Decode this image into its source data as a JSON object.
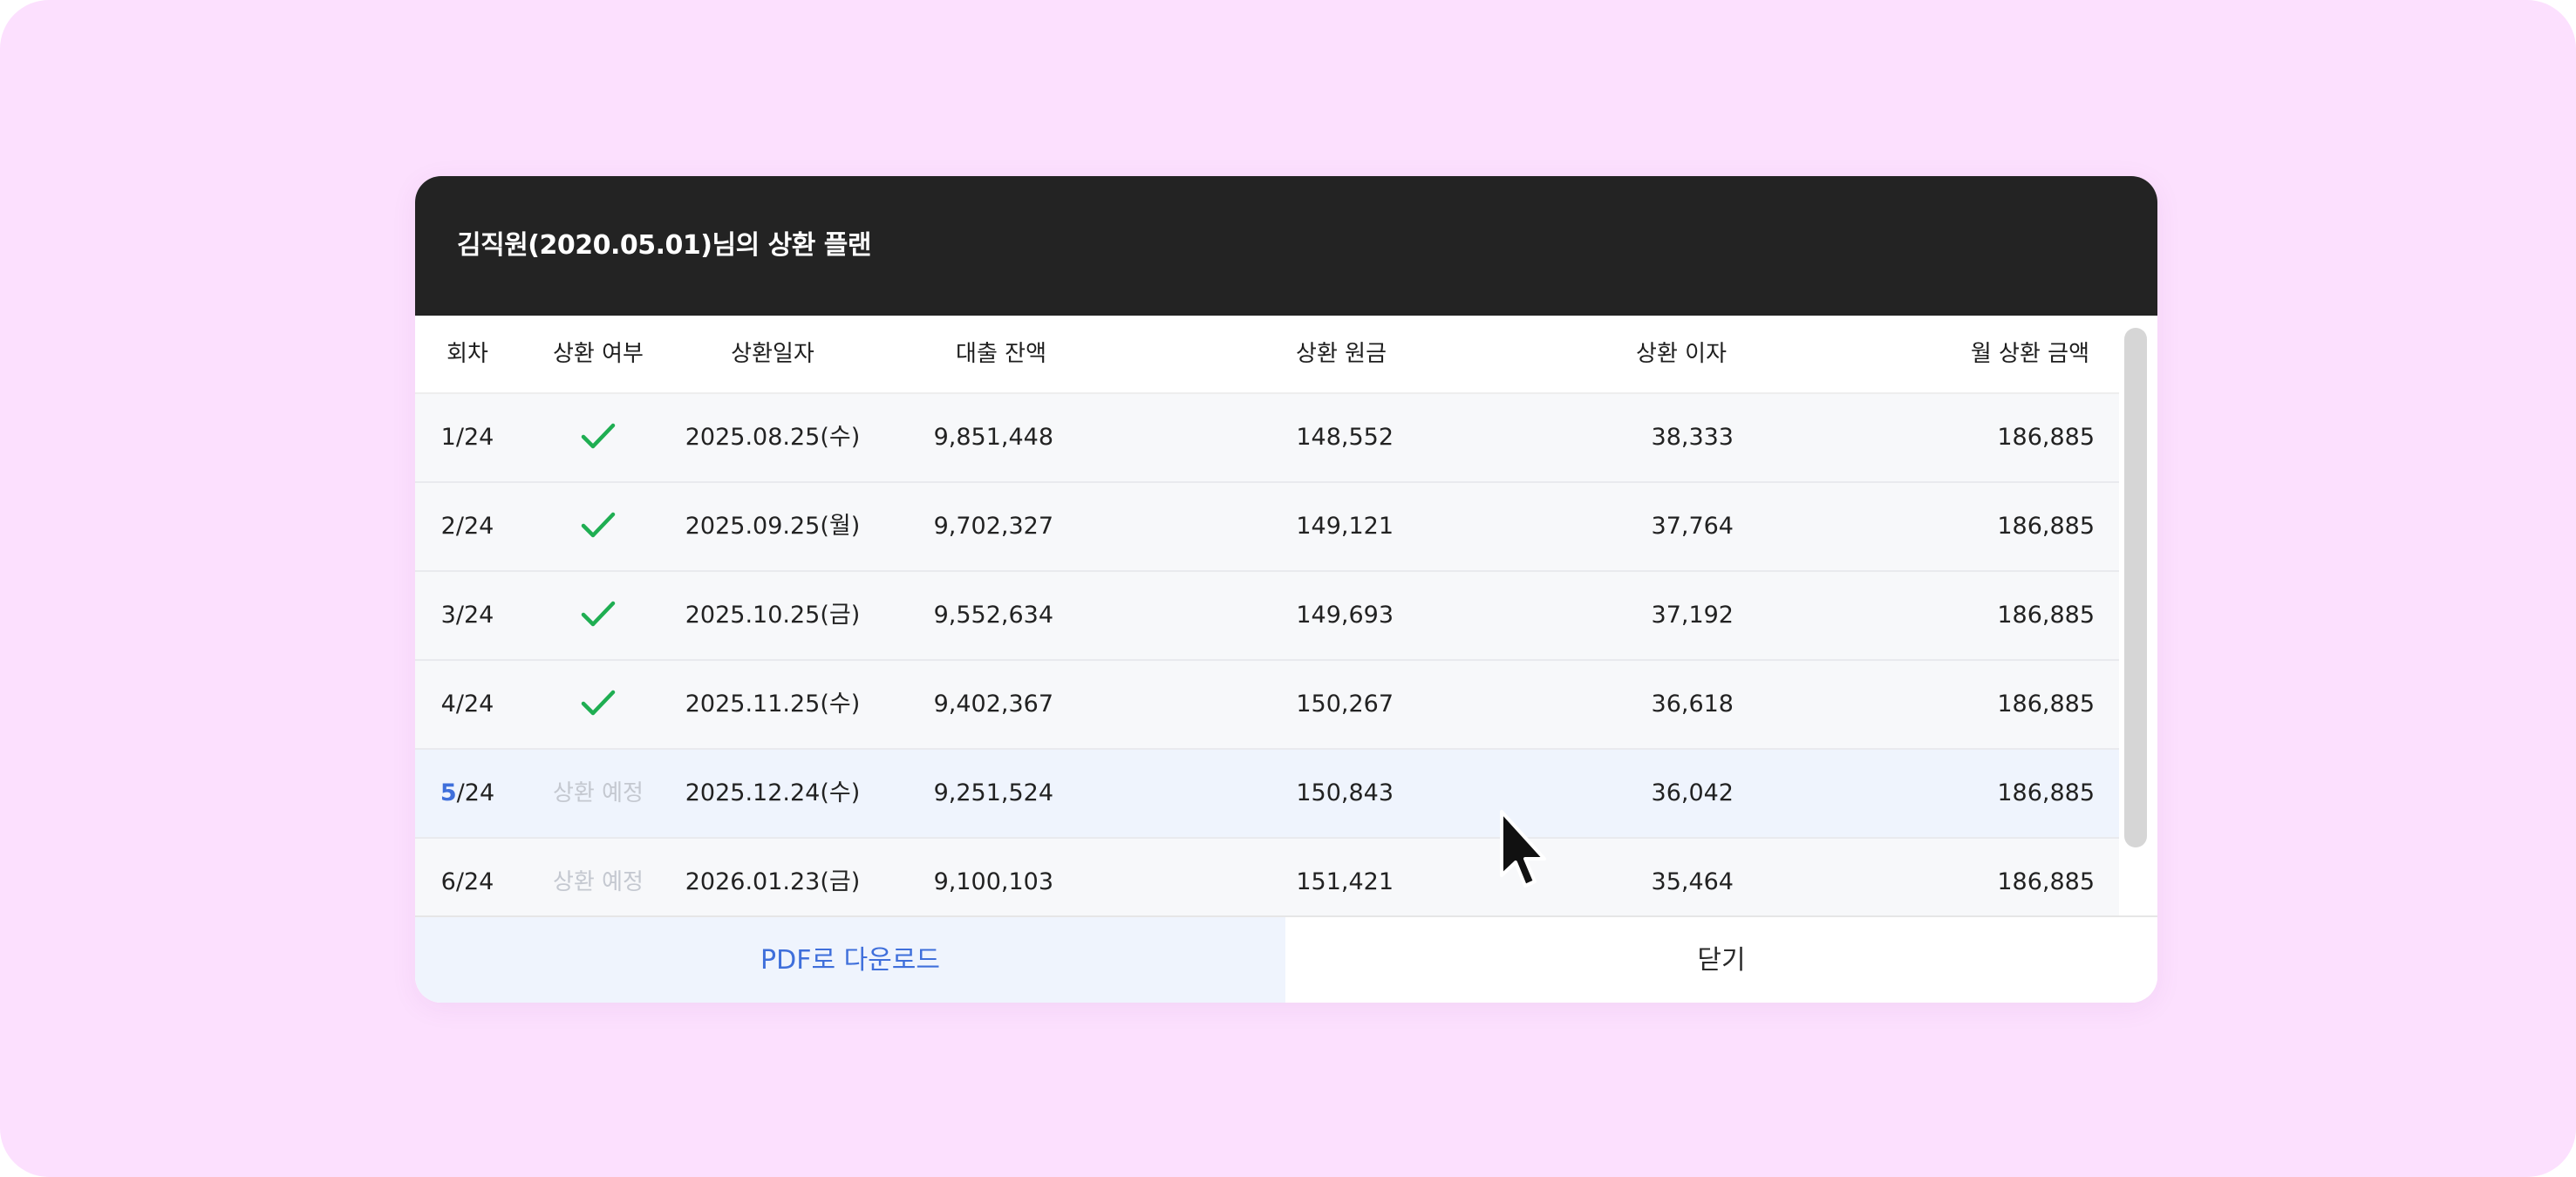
{
  "modal": {
    "title": "김직원(2020.05.01)님의 상환 플랜"
  },
  "table": {
    "headers": {
      "round": "회차",
      "status": "상환 여부",
      "date": "상환일자",
      "balance": "대출 잔액",
      "principal": "상환 원금",
      "interest": "상환 이자",
      "monthly": "월 상환 금액"
    },
    "rows": [
      {
        "round_num": "1",
        "round_total": "/24",
        "status": "check",
        "date": "2025.08.25(수)",
        "balance": "9,851,448",
        "principal": "148,552",
        "interest": "38,333",
        "monthly": "186,885"
      },
      {
        "round_num": "2",
        "round_total": "/24",
        "status": "check",
        "date": "2025.09.25(월)",
        "balance": "9,702,327",
        "principal": "149,121",
        "interest": "37,764",
        "monthly": "186,885"
      },
      {
        "round_num": "3",
        "round_total": "/24",
        "status": "check",
        "date": "2025.10.25(금)",
        "balance": "9,552,634",
        "principal": "149,693",
        "interest": "37,192",
        "monthly": "186,885"
      },
      {
        "round_num": "4",
        "round_total": "/24",
        "status": "check",
        "date": "2025.11.25(수)",
        "balance": "9,402,367",
        "principal": "150,267",
        "interest": "36,618",
        "monthly": "186,885"
      },
      {
        "round_num": "5",
        "round_total": "/24",
        "status": "상환 예정",
        "date": "2025.12.24(수)",
        "balance": "9,251,524",
        "principal": "150,843",
        "interest": "36,042",
        "monthly": "186,885"
      },
      {
        "round_num": "6",
        "round_total": "/24",
        "status": "상환 예정",
        "date": "2026.01.23(금)",
        "balance": "9,100,103",
        "principal": "151,421",
        "interest": "35,464",
        "monthly": "186,885"
      }
    ]
  },
  "footer": {
    "pdf_label": "PDF로 다운로드",
    "close_label": "닫기"
  },
  "colors": {
    "background": "#fce0fe",
    "header": "#232323",
    "accent": "#3f6fdb",
    "check": "#1fae52",
    "planned_text": "#c4c8d0",
    "current_row": "#eff4fd"
  },
  "icons": {
    "paid": "check-icon",
    "pointer": "mouse-cursor-icon"
  }
}
